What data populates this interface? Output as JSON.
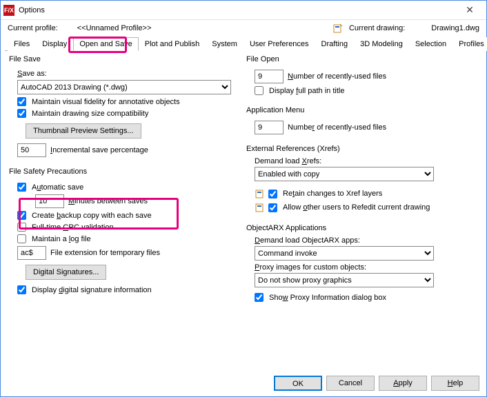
{
  "window": {
    "title": "Options",
    "icon": "F/X"
  },
  "profile": {
    "label": "Current profile:",
    "value": "<<Unnamed Profile>>",
    "drawing_label": "Current drawing:",
    "drawing_value": "Drawing1.dwg"
  },
  "tabs": {
    "items": [
      "Files",
      "Display",
      "Open and Save",
      "Plot and Publish",
      "System",
      "User Preferences",
      "Drafting",
      "3D Modeling",
      "Selection",
      "Profiles"
    ],
    "active_index": 2
  },
  "left": {
    "file_save": {
      "title": "File Save",
      "save_as_label": "Save as:",
      "save_as_value": "AutoCAD 2013 Drawing (*.dwg)",
      "visual_fidelity": "Maintain visual fidelity for annotative objects",
      "size_compat": "Maintain drawing size compatibility",
      "thumbnail_btn": "Thumbnail Preview Settings...",
      "incremental_value": "50",
      "incremental_label": "Incremental save percentage"
    },
    "safety": {
      "title": "File Safety Precautions",
      "auto_save": "Automatic save",
      "auto_value": "10",
      "auto_label": "Minutes between saves",
      "backup": "Create backup copy with each save",
      "crc": "Full-time CRC validation",
      "logfile": "Maintain a log file",
      "ext_value": "ac$",
      "ext_label": "File extension for temporary files",
      "sig_btn": "Digital Signatures...",
      "display_sig": "Display digital signature information"
    }
  },
  "right": {
    "file_open": {
      "title": "File Open",
      "recent_value": "9",
      "recent_label": "Number of recently-used files",
      "full_path": "Display full path in title"
    },
    "app_menu": {
      "title": "Application Menu",
      "recent_value": "9",
      "recent_label": "Number of recently-used files"
    },
    "xrefs": {
      "title": "External References (Xrefs)",
      "demand_label": "Demand load Xrefs:",
      "demand_value": "Enabled with copy",
      "retain": "Retain changes to Xref layers",
      "allow": "Allow other users to Refedit current drawing"
    },
    "objectarx": {
      "title": "ObjectARX Applications",
      "demand_label": "Demand load ObjectARX apps:",
      "demand_value": "Command invoke",
      "proxy_label": "Proxy images for custom objects:",
      "proxy_value": "Do not show proxy graphics",
      "show_proxy": "Show Proxy Information dialog box"
    }
  },
  "footer": {
    "ok": "OK",
    "cancel": "Cancel",
    "apply": "Apply",
    "help": "Help"
  }
}
